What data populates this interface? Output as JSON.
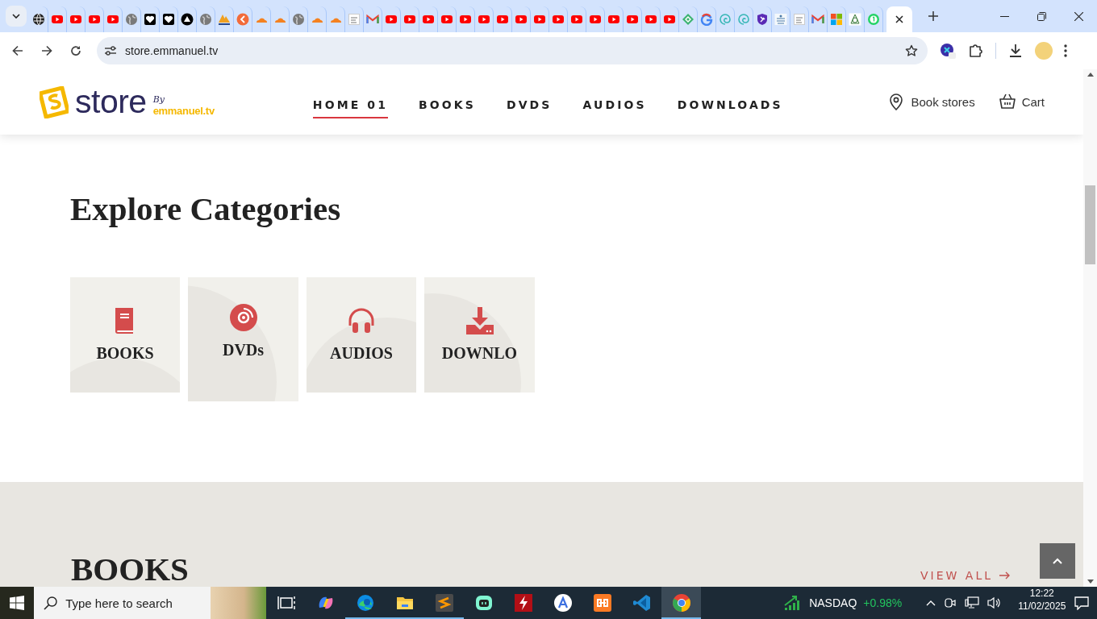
{
  "browser": {
    "tabs": [
      {
        "kind": "dark-globe",
        "selected": false
      },
      {
        "kind": "video",
        "selected": false
      },
      {
        "kind": "video",
        "selected": false
      },
      {
        "kind": "video",
        "selected": false
      },
      {
        "kind": "video",
        "selected": false
      },
      {
        "kind": "globe",
        "selected": false
      },
      {
        "kind": "heart",
        "selected": false
      },
      {
        "kind": "heart",
        "selected": false
      },
      {
        "kind": "triangle",
        "selected": false
      },
      {
        "kind": "globe",
        "selected": false
      },
      {
        "kind": "pyramid",
        "selected": false
      },
      {
        "kind": "orange-circle",
        "selected": false
      },
      {
        "kind": "cloud",
        "selected": false
      },
      {
        "kind": "cloud",
        "selected": false
      },
      {
        "kind": "globe",
        "selected": false
      },
      {
        "kind": "cloud",
        "selected": false
      },
      {
        "kind": "cloud",
        "selected": false
      },
      {
        "kind": "document",
        "selected": false
      },
      {
        "kind": "mail",
        "selected": false
      },
      {
        "kind": "video",
        "selected": false
      },
      {
        "kind": "video",
        "selected": false
      },
      {
        "kind": "video",
        "selected": false
      },
      {
        "kind": "video",
        "selected": false
      },
      {
        "kind": "video",
        "selected": false
      },
      {
        "kind": "video",
        "selected": false
      },
      {
        "kind": "video",
        "selected": false
      },
      {
        "kind": "video",
        "selected": false
      },
      {
        "kind": "video",
        "selected": false
      },
      {
        "kind": "video",
        "selected": false
      },
      {
        "kind": "video",
        "selected": false
      },
      {
        "kind": "video",
        "selected": false
      },
      {
        "kind": "video",
        "selected": false
      },
      {
        "kind": "video",
        "selected": false
      },
      {
        "kind": "video",
        "selected": false
      },
      {
        "kind": "video",
        "selected": false
      },
      {
        "kind": "diamond",
        "selected": false
      },
      {
        "kind": "g",
        "selected": false
      },
      {
        "kind": "spiral",
        "selected": false
      },
      {
        "kind": "spiral",
        "selected": false
      },
      {
        "kind": "shield",
        "selected": false
      },
      {
        "kind": "text-logo",
        "selected": false
      },
      {
        "kind": "document",
        "selected": false
      },
      {
        "kind": "mail",
        "selected": false
      },
      {
        "kind": "squares",
        "selected": false
      },
      {
        "kind": "seal",
        "selected": false
      },
      {
        "kind": "chat",
        "selected": false
      },
      {
        "kind": "none",
        "selected": true
      }
    ],
    "url": "store.emmanuel.tv"
  },
  "site": {
    "logo": {
      "word": "store",
      "by": "By",
      "brand": "emmanuel.tv"
    },
    "nav": [
      {
        "label": "HOME 01",
        "selected": true
      },
      {
        "label": "BOOKS",
        "selected": false
      },
      {
        "label": "DVDS",
        "selected": false
      },
      {
        "label": "AUDIOS",
        "selected": false
      },
      {
        "label": "DOWNLOADS",
        "selected": false
      }
    ],
    "actions": [
      {
        "kind": "location",
        "label": "Book stores"
      },
      {
        "kind": "cart",
        "label": "Cart"
      }
    ]
  },
  "categories": {
    "heading": "Explore Categories",
    "items": [
      {
        "kind": "book",
        "label": "BOOKS"
      },
      {
        "kind": "disc",
        "label": "DVDs"
      },
      {
        "kind": "headphones",
        "label": "AUDIOS"
      },
      {
        "kind": "download",
        "label": "DOWNLO"
      }
    ]
  },
  "books": {
    "heading": "BOOKS",
    "link": "VIEW ALL"
  },
  "taskbar": {
    "search_placeholder": "Type here to search",
    "apps": [
      {
        "kind": "task-view",
        "running": false,
        "selected": false
      },
      {
        "kind": "swirl",
        "running": false,
        "selected": false
      },
      {
        "kind": "wave",
        "running": true,
        "selected": false
      },
      {
        "kind": "folder",
        "running": true,
        "selected": false
      },
      {
        "kind": "s-tile",
        "running": true,
        "selected": false
      },
      {
        "kind": "robot",
        "running": false,
        "selected": false
      },
      {
        "kind": "bolt",
        "running": false,
        "selected": false
      },
      {
        "kind": "a-circle",
        "running": false,
        "selected": false
      },
      {
        "kind": "knot",
        "running": false,
        "selected": false
      },
      {
        "kind": "code",
        "running": false,
        "selected": false
      },
      {
        "kind": "browser",
        "running": true,
        "selected": true
      }
    ],
    "ticker": {
      "name": "NASDAQ",
      "change": "+0.98%"
    },
    "time": "12:22",
    "date": "11/02/2025"
  }
}
